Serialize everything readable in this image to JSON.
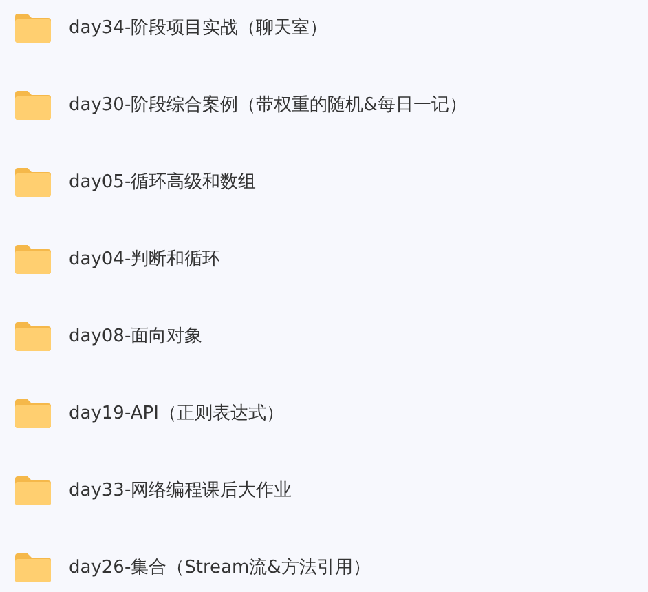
{
  "folders": [
    {
      "name": "day34-阶段项目实战（聊天室）"
    },
    {
      "name": "day30-阶段综合案例（带权重的随机&每日一记）"
    },
    {
      "name": "day05-循环高级和数组"
    },
    {
      "name": "day04-判断和循环"
    },
    {
      "name": "day08-面向对象"
    },
    {
      "name": "day19-API（正则表达式）"
    },
    {
      "name": "day33-网络编程课后大作业"
    },
    {
      "name": "day26-集合（Stream流&方法引用）"
    }
  ]
}
